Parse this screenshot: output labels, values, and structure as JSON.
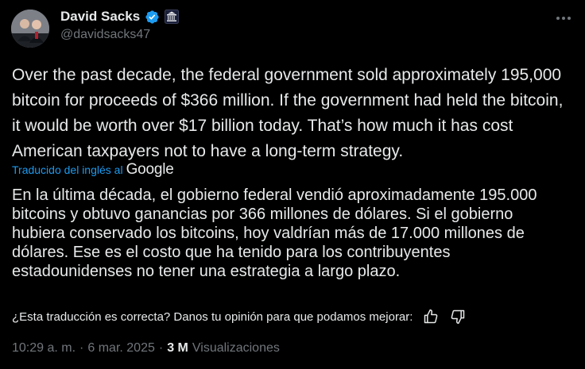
{
  "author": {
    "display_name": "David Sacks",
    "handle": "@davidsacks47"
  },
  "tweet": {
    "text": "Over the past decade, the federal government sold approximately 195,000 bitcoin for proceeds of $366 million. If the government had held the bitcoin, it would be worth over $17 billion today. That’s how much it has cost American taxpayers not to have a long-term strategy."
  },
  "translation": {
    "label": "Traducido del inglés al",
    "provider": "Google",
    "text": "En la última década, el gobierno federal vendió aproximadamente 195.000 bitcoins y obtuvo ganancias por 366 millones de dólares. Si el gobierno hubiera conservado los bitcoins, hoy valdrían más de 17.000 millones de dólares. Ese es el costo que ha tenido para los contribuyentes estadounidenses no tener una estrategia a largo plazo."
  },
  "feedback": {
    "prompt": "¿Esta traducción es correcta? Danos tu opinión para que podamos mejorar:"
  },
  "meta": {
    "time": "10:29 a. m.",
    "separator": "·",
    "date": "6 mar. 2025",
    "views_count": "3 M",
    "views_label": "Visualizaciones"
  },
  "icons": {
    "verified": "verified-badge-icon",
    "affiliation": "white-house-affiliation-icon",
    "more": "more-options-icon",
    "thumbs_up": "thumbs-up-icon",
    "thumbs_down": "thumbs-down-icon"
  },
  "colors": {
    "background": "#000000",
    "text": "#e7e9ea",
    "secondary": "#71767b",
    "link": "#1d9bf0",
    "verified": "#1d9bf0"
  }
}
